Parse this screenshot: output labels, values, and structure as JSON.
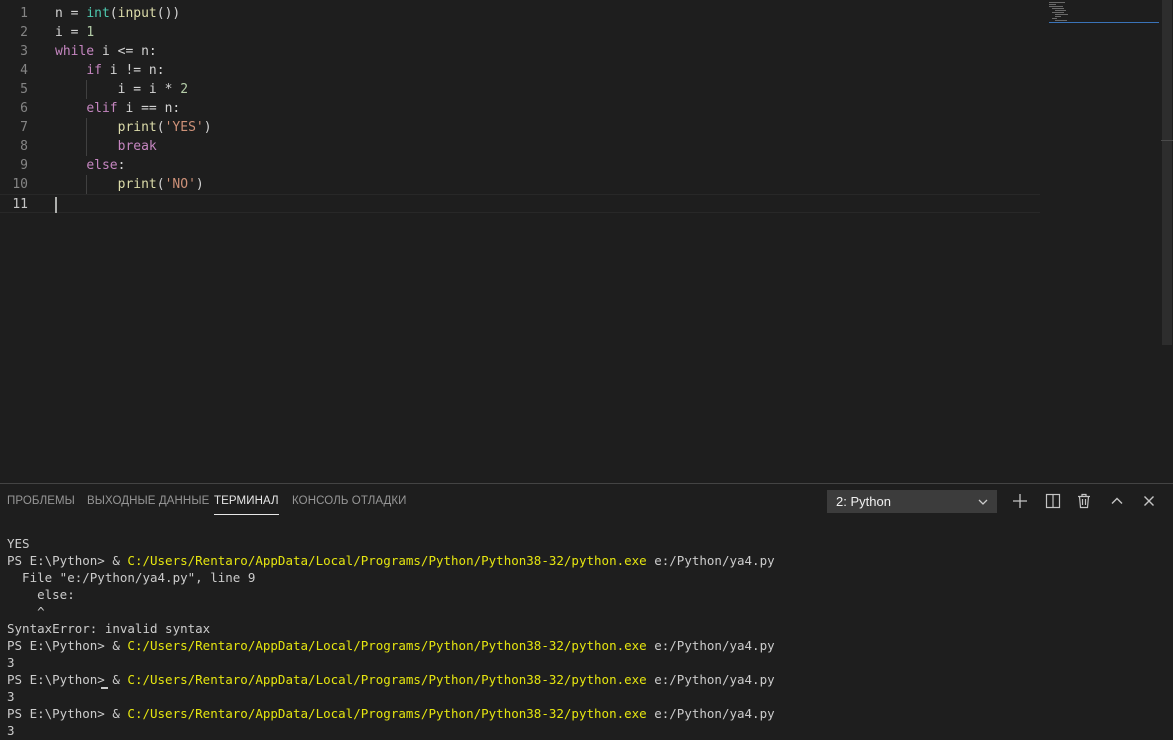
{
  "editor": {
    "line_numbers": [
      "1",
      "2",
      "3",
      "4",
      "5",
      "6",
      "7",
      "8",
      "9",
      "10",
      "11"
    ],
    "lines": [
      [
        {
          "t": "n = ",
          "c": "p"
        },
        {
          "t": "int",
          "c": "bi"
        },
        {
          "t": "(",
          "c": "p"
        },
        {
          "t": "input",
          "c": "fn"
        },
        {
          "t": "())",
          "c": "p"
        }
      ],
      [
        {
          "t": "i = ",
          "c": "p"
        },
        {
          "t": "1",
          "c": "num"
        }
      ],
      [
        {
          "t": "while",
          "c": "kw"
        },
        {
          "t": " i <= n:",
          "c": "p"
        }
      ],
      [
        {
          "t": "    ",
          "c": "p"
        },
        {
          "t": "if",
          "c": "kw"
        },
        {
          "t": " i != n:",
          "c": "p"
        }
      ],
      [
        {
          "t": "        i = i * ",
          "c": "p"
        },
        {
          "t": "2",
          "c": "num"
        }
      ],
      [
        {
          "t": "    ",
          "c": "p"
        },
        {
          "t": "elif",
          "c": "kw"
        },
        {
          "t": " i == n:",
          "c": "p"
        }
      ],
      [
        {
          "t": "        ",
          "c": "p"
        },
        {
          "t": "print",
          "c": "fn"
        },
        {
          "t": "(",
          "c": "p"
        },
        {
          "t": "'YES'",
          "c": "str"
        },
        {
          "t": ")",
          "c": "p"
        }
      ],
      [
        {
          "t": "        ",
          "c": "p"
        },
        {
          "t": "break",
          "c": "kw"
        }
      ],
      [
        {
          "t": "    ",
          "c": "p"
        },
        {
          "t": "else",
          "c": "kw"
        },
        {
          "t": ":",
          "c": "p"
        }
      ],
      [
        {
          "t": "        ",
          "c": "p"
        },
        {
          "t": "print",
          "c": "fn"
        },
        {
          "t": "(",
          "c": "p"
        },
        {
          "t": "'NO'",
          "c": "str"
        },
        {
          "t": ")",
          "c": "p"
        }
      ],
      [
        {
          "t": "",
          "c": "p"
        }
      ]
    ],
    "current_line": 11
  },
  "panel": {
    "tabs": [
      {
        "label": "ПРОБЛЕМЫ",
        "active": false
      },
      {
        "label": "ВЫХОДНЫЕ ДАННЫЕ",
        "active": false
      },
      {
        "label": "ТЕРМИНАЛ",
        "active": true
      },
      {
        "label": "КОНСОЛЬ ОТЛАДКИ",
        "active": false
      }
    ],
    "terminal_select": "2: Python",
    "actions": [
      "plus-icon",
      "split-icon",
      "trash-icon",
      "chevron-up-icon",
      "close-icon"
    ]
  },
  "terminal": {
    "lines": [
      [
        {
          "t": "YES"
        }
      ],
      [
        {
          "t": "PS E:\\Python> & "
        },
        {
          "t": "C:/Users/Rentaro/AppData/Local/Programs/Python/Python38-32/python.exe",
          "c": "path"
        },
        {
          "t": " e:/Python/ya4.py"
        }
      ],
      [
        {
          "t": "  File \"e:/Python/ya4.py\", line 9"
        }
      ],
      [
        {
          "t": "    else:"
        }
      ],
      [
        {
          "t": "    ^"
        }
      ],
      [
        {
          "t": "SyntaxError: invalid syntax"
        }
      ],
      [
        {
          "t": "PS E:\\Python> & "
        },
        {
          "t": "C:/Users/Rentaro/AppData/Local/Programs/Python/Python38-32/python.exe",
          "c": "path"
        },
        {
          "t": " e:/Python/ya4.py"
        }
      ],
      [
        {
          "t": "3"
        }
      ],
      [
        {
          "t": "PS E:\\Python> & "
        },
        {
          "t": "C:/Users/Rentaro/AppData/Local/Programs/Python/Python38-32/python.exe",
          "c": "path"
        },
        {
          "t": " e:/Python/ya4.py"
        }
      ],
      [
        {
          "t": "3"
        }
      ],
      [
        {
          "t": "PS E:\\Python> & "
        },
        {
          "t": "C:/Users/Rentaro/AppData/Local/Programs/Python/Python38-32/python.exe",
          "c": "path"
        },
        {
          "t": " e:/Python/ya4.py"
        }
      ],
      [
        {
          "t": "3"
        }
      ]
    ]
  },
  "colors": {
    "background": "#1e1e1e",
    "keyword": "#c586c0",
    "function": "#dcdcaa",
    "builtin": "#4ec9b0",
    "number": "#b5cea8",
    "string": "#ce9178",
    "terminal_path": "#e5e510"
  }
}
